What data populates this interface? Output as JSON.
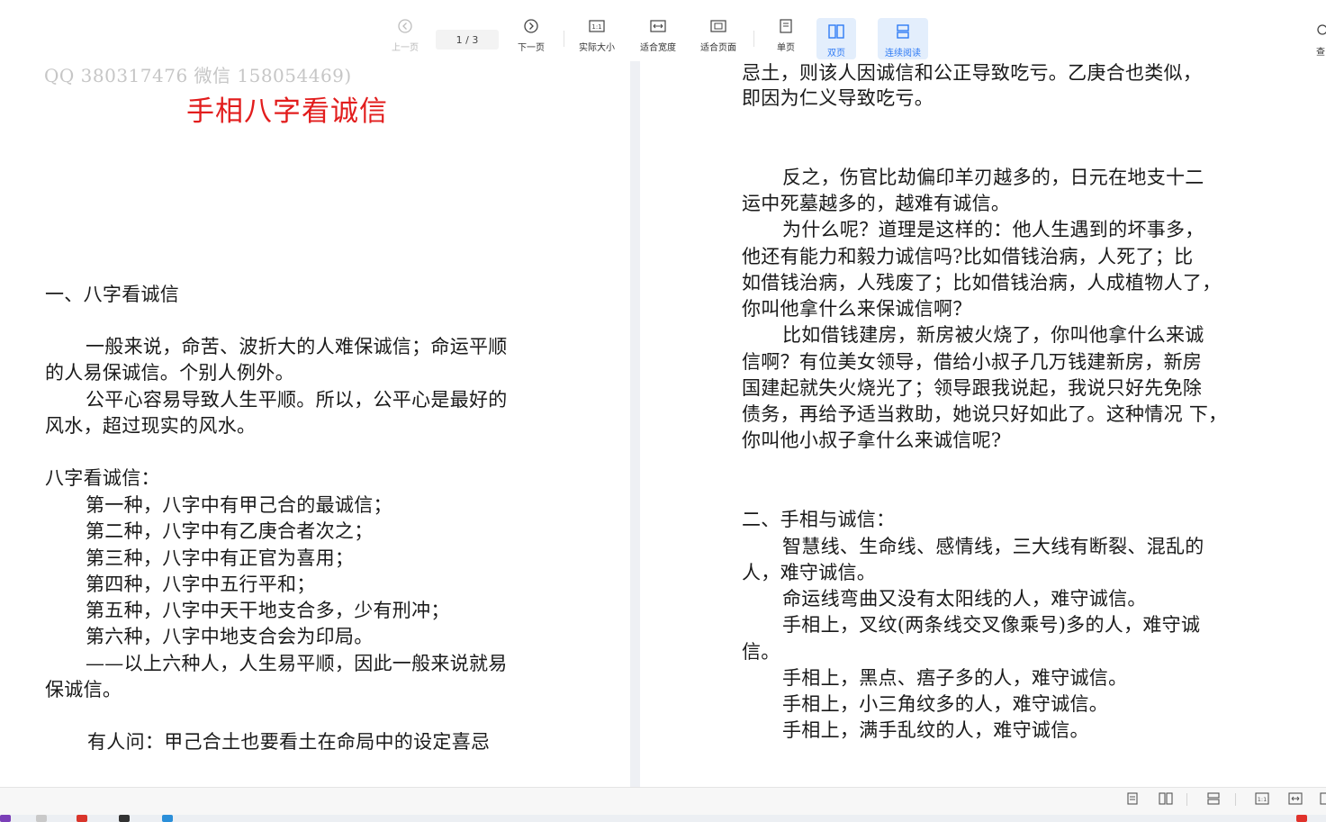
{
  "toolbar": {
    "prev": "上一页",
    "page_indicator": "1 / 3",
    "next": "下一页",
    "actual_size": "实际大小",
    "fit_width": "适合宽度",
    "fit_page": "适合页面",
    "single": "单页",
    "double": "双页",
    "continuous": "连续阅读",
    "cut_right": "查"
  },
  "colors": {
    "accent": "#2f7bf5",
    "title_red": "#e21d1d",
    "watermark": "#c6c6c6"
  },
  "left_page": {
    "watermark": "QQ 380317476  微信 158054469)",
    "title": "手相八字看诚信",
    "lines": [
      "一、八字看诚信",
      "一般来说，命苦、波折大的人难保诚信；命运平顺",
      "的人易保诚信。个别人例外。",
      "公平心容易导致人生平顺。所以，公平心是最好的",
      "风水，超过现实的风水。",
      "八字看诚信：",
      "第一种，八字中有甲己合的最诚信；",
      "第二种，八字中有乙庚合者次之；",
      "第三种，八字中有正官为喜用；",
      "第四种，八字中五行平和；",
      "第五种，八字中天干地支合多，少有刑冲；",
      "第六种，八字中地支合会为印局。",
      "——以上六种人，人生易平顺，因此一般来说就易",
      "保诚信。",
      "有人问：甲己合土也要看土在命局中的设定喜忌"
    ]
  },
  "right_page": {
    "lines": [
      "忌土，则该人因诚信和公正导致吃亏。乙庚合也类似，",
      "即因为仁义导致吃亏。",
      "反之，伤官比劫偏印羊刃越多的，日元在地支十二",
      "运中死墓越多的，越难有诚信。",
      "为什么呢？道理是这样的：他人生遇到的坏事多，",
      "他还有能力和毅力诚信吗?比如借钱治病，人死了；比",
      "如借钱治病，人残废了；比如借钱治病，人成植物人了，",
      "你叫他拿什么来保诚信啊？",
      "比如借钱建房，新房被火烧了，你叫他拿什么来诚",
      "信啊？有位美女领导，借给小叔子几万钱建新房，新房",
      "国建起就失火烧光了；领导跟我说起，我说只好先免除",
      "债务，再给予适当救助，她说只好如此了。这种情况 下，",
      "你叫他小叔子拿什么来诚信呢?",
      "二、手相与诚信：",
      "智慧线、生命线、感情线，三大线有断裂、混乱的",
      "人，难守诚信。",
      "命运线弯曲又没有太阳线的人，难守诚信。",
      "手相上，叉纹(两条线交叉像乘号)多的人，难守诚",
      "信。",
      "手相上，黑点、痦子多的人，难守诚信。",
      "手相上，小三角纹多的人，难守诚信。",
      "手相上，满手乱纹的人，难守诚信。"
    ]
  }
}
